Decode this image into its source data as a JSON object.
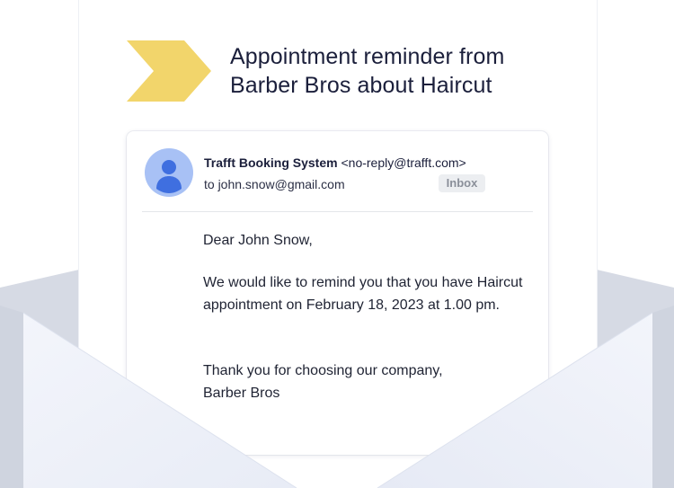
{
  "heading": {
    "line1": "Appointment reminder from",
    "line2": "Barber Bros about Haircut"
  },
  "email": {
    "sender_name": "Trafft Booking System",
    "sender_address": "<no-reply@trafft.com>",
    "recipient": "to john.snow@gmail.com",
    "folder_badge": "Inbox",
    "greeting": "Dear John Snow,",
    "paragraph1": "We would like to remind you that you have Haircut appointment on February 18, 2023 at 1.00 pm.",
    "closing_line1": "Thank you for choosing our company,",
    "closing_line2": "Barber Bros"
  },
  "icons": {
    "avatar": "user-avatar-icon",
    "arrow": "chevron-arrow-icon"
  },
  "colors": {
    "arrow": "#f2d56b",
    "avatar_bg": "#a8c1f5",
    "avatar_fg": "#3f6fe0",
    "envelope_light": "#eef1f9",
    "envelope_side": "#d3d7e2"
  }
}
